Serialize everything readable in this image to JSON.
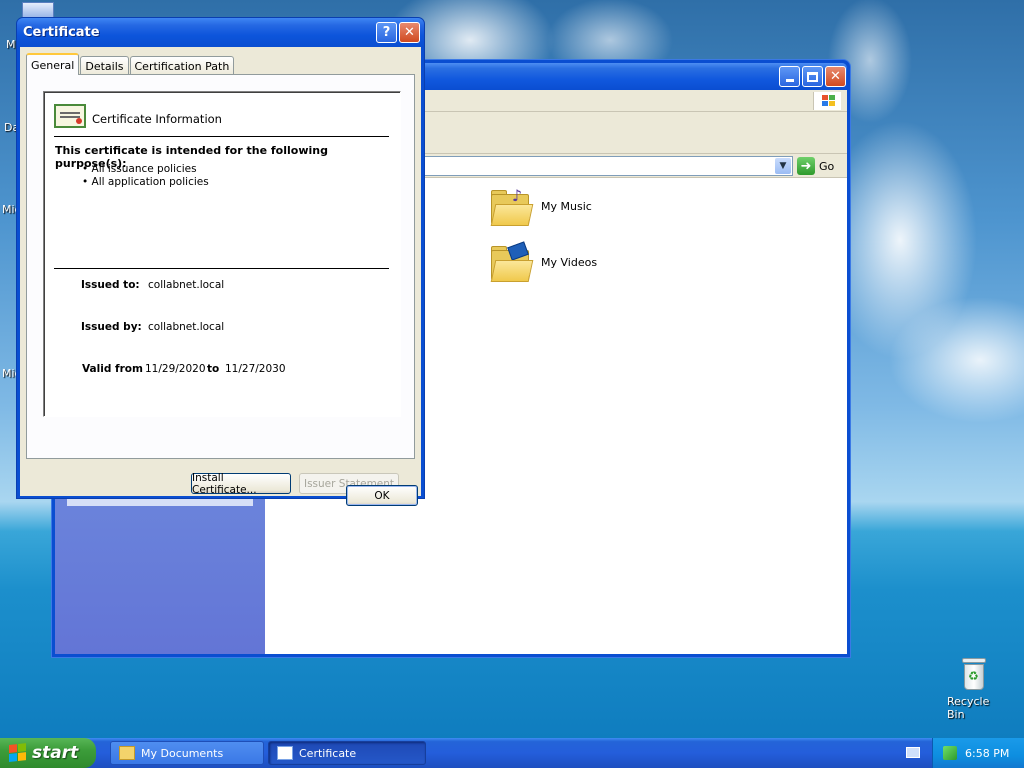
{
  "desktop": {
    "icon_labels": [
      "My",
      "Da",
      "Mic",
      "Mic"
    ],
    "recycle_bin_label": "Recycle Bin"
  },
  "explorer": {
    "go_label": "Go",
    "items": [
      {
        "label": "My Music",
        "icon": "music-folder-icon"
      },
      {
        "label": "My Videos",
        "icon": "video-folder-icon"
      }
    ]
  },
  "dialog": {
    "title": "Certificate",
    "help_glyph": "?",
    "close_glyph": "✕",
    "tabs": [
      "General",
      "Details",
      "Certification Path"
    ],
    "active_tab": "General",
    "heading": "Certificate Information",
    "purpose_title": "This certificate is intended for the following purpose(s):",
    "purposes": [
      "• All issuance policies",
      "• All application policies"
    ],
    "issued_to_label": "Issued to:",
    "issued_to_value": "collabnet.local",
    "issued_by_label": "Issued by:",
    "issued_by_value": "collabnet.local",
    "valid_from_label": "Valid from",
    "valid_from_value": "11/29/2020",
    "valid_to_label": "to",
    "valid_to_value": "11/27/2030",
    "install_button": "Install Certificate...",
    "issuer_button": "Issuer Statement",
    "ok_button": "OK"
  },
  "taskbar": {
    "start_label": "start",
    "tasks": [
      {
        "label": "My Documents",
        "active": false
      },
      {
        "label": "Certificate",
        "active": true
      }
    ],
    "clock": "6:58 PM"
  },
  "colors": {
    "xp_blue": "#0a4ed1",
    "dialog_face": "#ece9d8",
    "start_green": "#3c9d3a",
    "tab_highlight": "#ffc83c"
  }
}
